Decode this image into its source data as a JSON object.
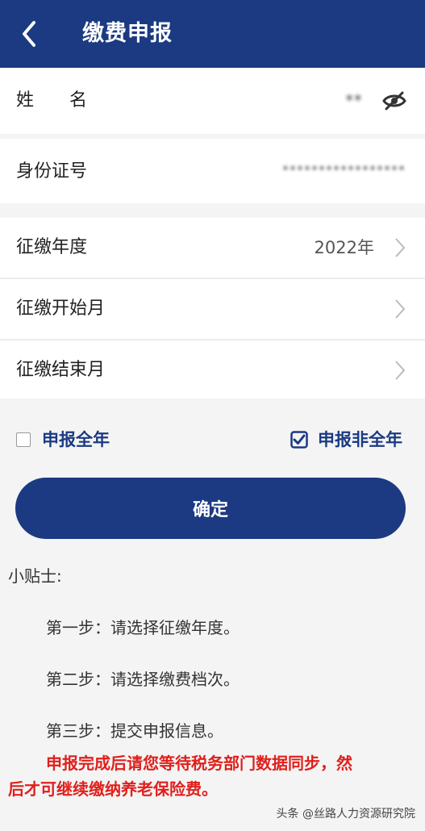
{
  "header": {
    "title": "缴费申报"
  },
  "name_row": {
    "label": "姓　　名",
    "value": "**"
  },
  "id_row": {
    "label": "身份证号",
    "value": "*****************"
  },
  "year_row": {
    "label": "征缴年度",
    "value": "2022年"
  },
  "start_row": {
    "label": "征缴开始月"
  },
  "end_row": {
    "label": "征缴结束月"
  },
  "options": {
    "full_year": "申报全年",
    "partial_year": "申报非全年",
    "full_year_checked": false,
    "partial_year_checked": true
  },
  "confirm_label": "确定",
  "tips": {
    "title": "小贴士:",
    "step1": "第一步：请选择征缴年度。",
    "step2": "第二步：请选择缴费档次。",
    "step3": "第三步：提交申报信息。",
    "warning_line1": "申报完成后请您等待税务部门数据同步，然",
    "warning_line2": "后才可继续缴纳养老保险费。"
  },
  "watermark": "头条 @丝路人力资源研究院",
  "colors": {
    "primary": "#1b3a82",
    "warning": "#e0201c"
  }
}
